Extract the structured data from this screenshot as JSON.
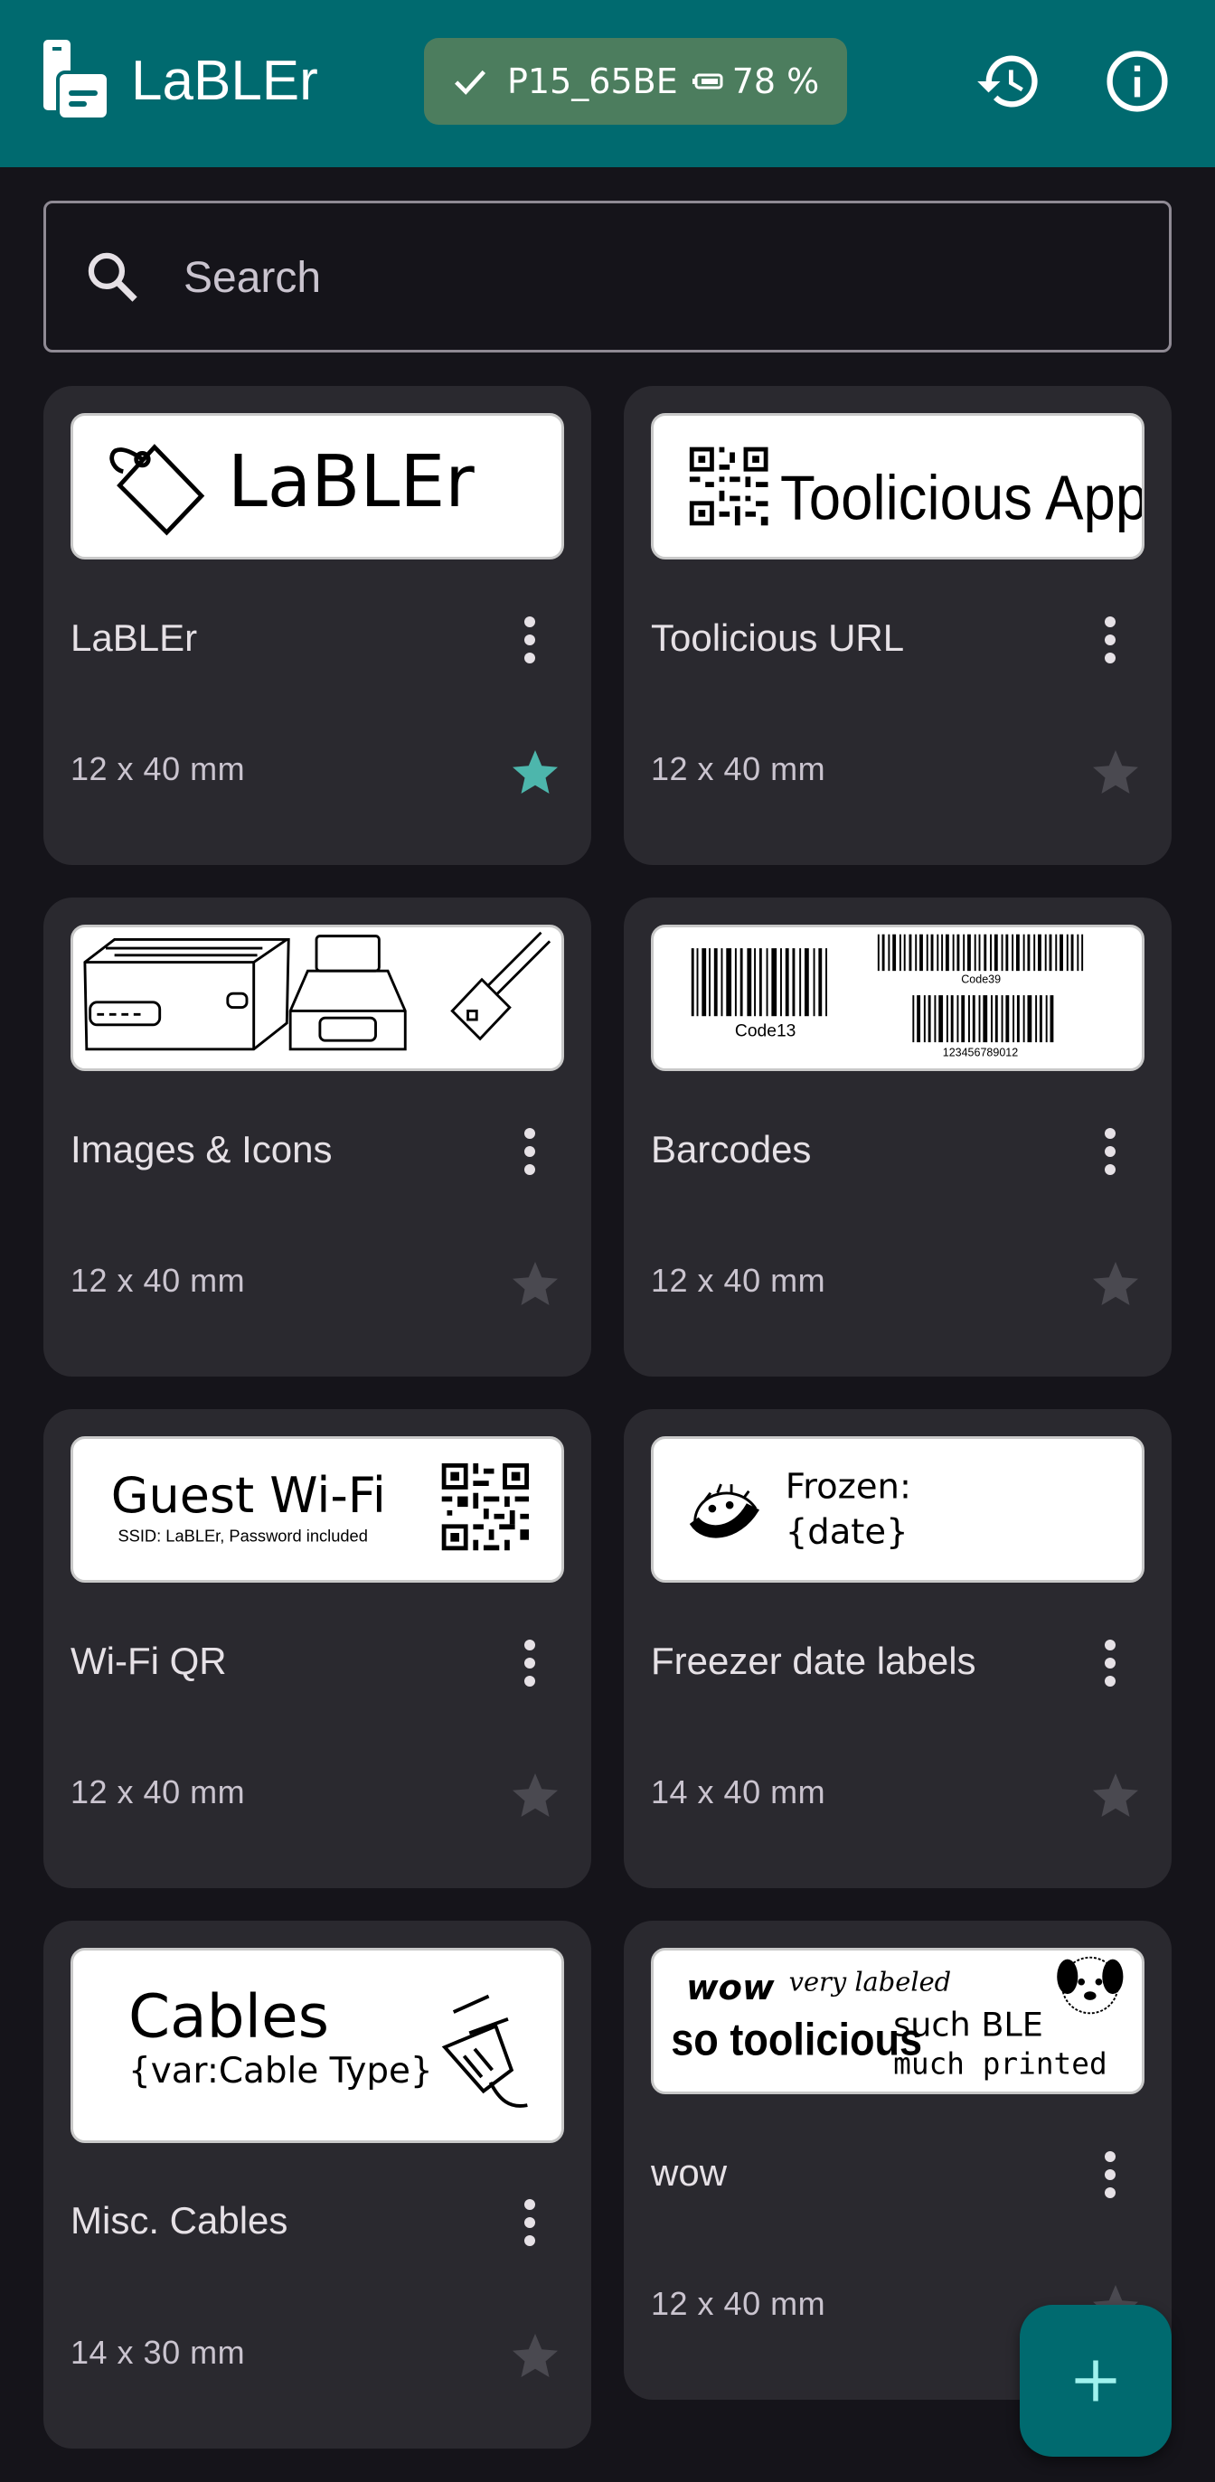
{
  "app": {
    "title": "LaBLEr",
    "printer_chip": "P15_65BE",
    "battery": "78 %",
    "history_icon": "history-icon",
    "info_icon": "info-icon"
  },
  "search": {
    "placeholder": "Search",
    "value": ""
  },
  "colors": {
    "appbar": "#006a6f",
    "chip": "#4c7d5e",
    "card": "#2a292f",
    "background": "#15141a",
    "star_active": "#4db6ac",
    "star_inactive": "#4a4950"
  },
  "cards": [
    {
      "name": "LaBLEr",
      "size": "12 x 40 mm",
      "favorite": true,
      "preview": {
        "text": "LaBLEr",
        "icon": "tag-icon"
      }
    },
    {
      "name": "Toolicious URL",
      "size": "12 x 40 mm",
      "favorite": false,
      "preview": {
        "text": "Toolicious Apps",
        "icon": "qr-code-icon"
      }
    },
    {
      "name": "Images & Icons",
      "size": "12 x 40 mm",
      "favorite": false,
      "preview": {
        "icon": "printer-usb-icon"
      }
    },
    {
      "name": "Barcodes",
      "size": "12 x 40 mm",
      "favorite": false,
      "preview": {
        "code1": "Code13",
        "code2": "Code39",
        "code3": "123456789012",
        "icon": "barcode-icon"
      }
    },
    {
      "name": "Wi-Fi QR",
      "size": "12 x 40 mm",
      "favorite": false,
      "preview": {
        "text": "Guest Wi-Fi",
        "subtext": "SSID: LaBLEr, Password included",
        "icon": "qr-code-icon"
      }
    },
    {
      "name": "Freezer date labels",
      "size": "14 x 40 mm",
      "favorite": false,
      "preview": {
        "line1": "Frozen:",
        "line2": "{date}",
        "icon": "taco-icon"
      }
    },
    {
      "name": "Misc. Cables",
      "size": "14 x 30 mm",
      "favorite": false,
      "preview": {
        "line1": "Cables",
        "line2": "{var:Cable Type}",
        "icon": "plug-icon"
      }
    },
    {
      "name": "wow",
      "size": "12 x 40 mm",
      "favorite": false,
      "preview": {
        "t1": "wow",
        "t2": "very labeled",
        "t3": "so toolicious",
        "t4": "such BLE",
        "t5": "much printed",
        "icon": "dog-icon"
      }
    }
  ],
  "fab": {
    "icon": "add-icon"
  }
}
